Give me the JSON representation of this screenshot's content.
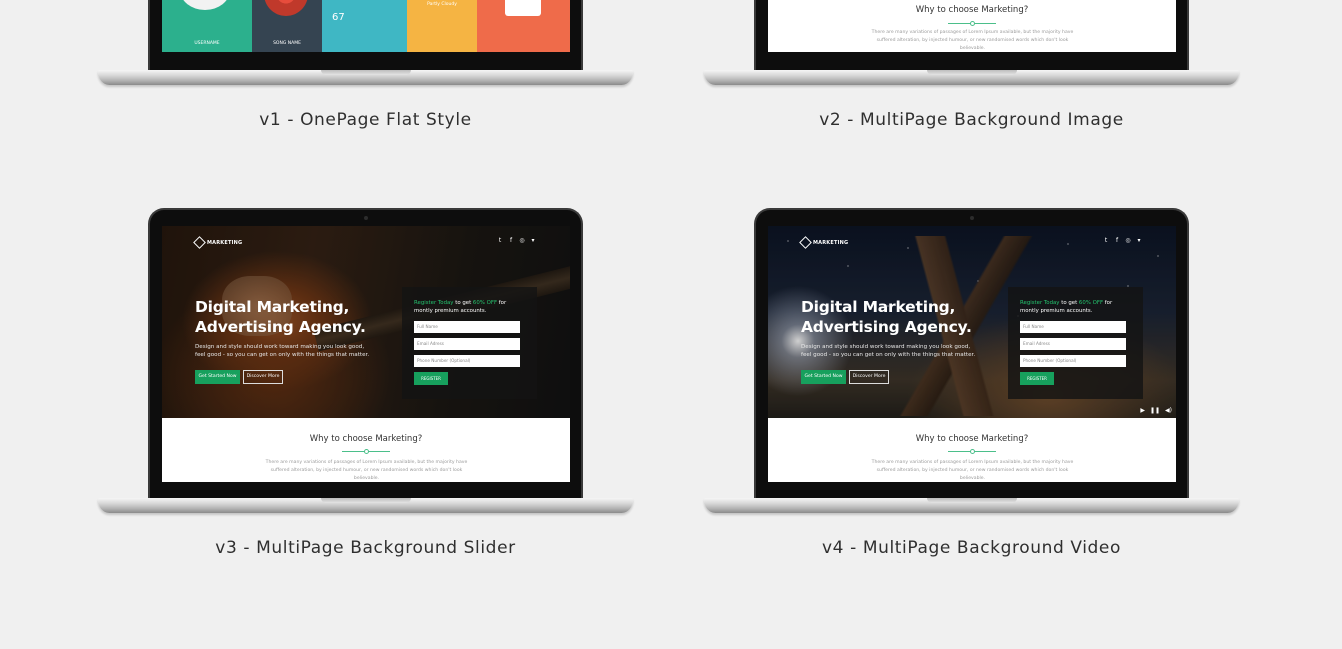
{
  "page": {
    "background": "#f0f0f0"
  },
  "demos": [
    {
      "title": "v1 - OnePage Flat Style",
      "screen": {
        "tile_labels": [
          "USERNAME",
          "SONG NAME",
          "67",
          "Partly Cloudy",
          ""
        ]
      }
    },
    {
      "title": "v2 - MultiPage Background Image",
      "screen": {
        "why_title": "Why to choose Marketing?",
        "lorem": "There are many variations of passages of Lorem Ipsum available, but the majority have suffered alteration, by injected humour, or new randomised words which don't look believable."
      }
    },
    {
      "title": "v3 - MultiPage Background Slider",
      "screen": {
        "logo": "MARKETING",
        "headline": "Digital Marketing, Advertising Agency.",
        "subtext": "Design and style should work toward making you look good, feel good - so you can get on only with the things that matter.",
        "primary_button": "Get Started Now",
        "secondary_button": "Discover More",
        "form_lead_green": "Register Today",
        "form_lead_mid": "to get",
        "form_lead_offer": "60% OFF",
        "form_lead_tail": "for montly premium accounts.",
        "field_name": "Full Name",
        "field_email": "Email Adress",
        "field_phone": "Phone Number (Optional)",
        "register_button": "REGISTER",
        "why_title": "Why to choose Marketing?",
        "lorem": "There are many variations of passages of Lorem Ipsum available, but the majority have suffered alteration, by injected humour, or new randomised words which don't look believable."
      }
    },
    {
      "title": "v4 - MultiPage Background Video",
      "screen": {
        "logo": "MARKETING",
        "headline": "Digital Marketing, Advertising Agency.",
        "subtext": "Design and style should work toward making you look good, feel good - so you can get on only with the things that matter.",
        "primary_button": "Get Started Now",
        "secondary_button": "Discover More",
        "form_lead_green": "Register Today",
        "form_lead_mid": "to get",
        "form_lead_offer": "60% OFF",
        "form_lead_tail": "for montly premium accounts.",
        "field_name": "Full Name",
        "field_email": "Email Adress",
        "field_phone": "Phone Number (Optional)",
        "register_button": "REGISTER",
        "why_title": "Why to choose Marketing?",
        "lorem": "There are many variations of passages of Lorem Ipsum available, but the majority have suffered alteration, by injected humour, or new randomised words which don't look believable."
      }
    }
  ],
  "icons": {
    "socials": [
      "twitter-icon",
      "facebook-icon",
      "dribbble-icon",
      "pinterest-icon"
    ],
    "video_controls": [
      "play-icon",
      "pause-icon",
      "volume-icon"
    ]
  },
  "colors": {
    "accent_green": "#17a05d",
    "title_text": "#2f2f2f"
  }
}
